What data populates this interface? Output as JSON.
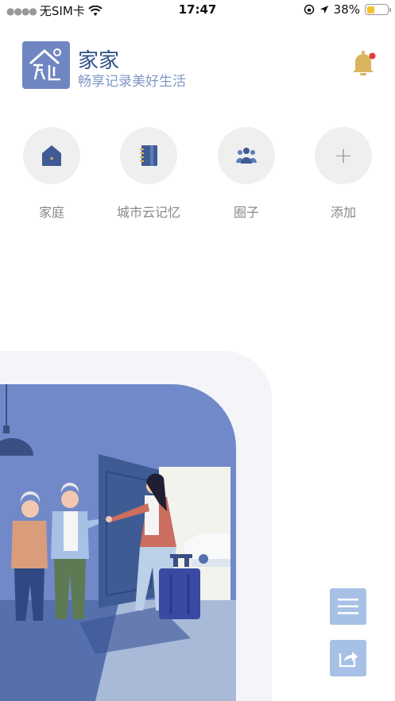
{
  "status_bar": {
    "carrier": "无SIM卡",
    "time": "17:47",
    "battery_percent": "38%",
    "battery_level": 0.38,
    "icons": [
      "wifi-icon",
      "lock-rotation-icon",
      "location-arrow-icon",
      "battery-icon"
    ]
  },
  "header": {
    "logo_icon": "home-logo-icon",
    "title": "家家",
    "subtitle": "畅享记录美好生活",
    "bell_icon": "notification-bell-icon",
    "has_unread": true
  },
  "shortcuts": [
    {
      "icon": "house-icon",
      "label": "家庭"
    },
    {
      "icon": "notebook-icon",
      "label": "城市云记忆"
    },
    {
      "icon": "group-icon",
      "label": "圈子"
    },
    {
      "icon": "plus-icon",
      "label": "添加"
    }
  ],
  "floating_buttons": {
    "menu_icon": "menu-icon",
    "share_icon": "share-icon"
  },
  "colors": {
    "accent": "#2f4f86",
    "subtitle": "#7f97c8",
    "logo_bg": "#6f86c2",
    "bell": "#d9b560",
    "badge": "#e53935",
    "fab_bg": "#a7c1e6"
  }
}
